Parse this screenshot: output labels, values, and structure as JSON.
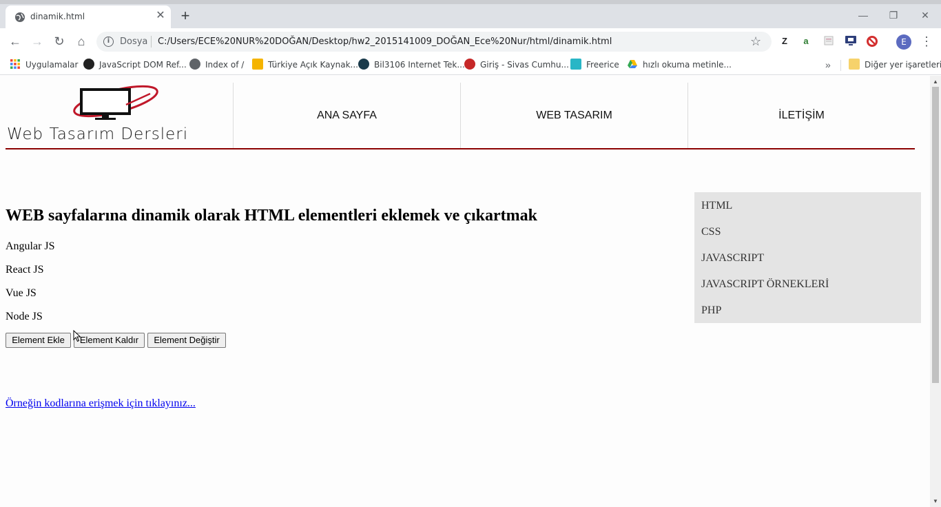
{
  "browser": {
    "tab_title": "dinamik.html",
    "address_scheme": "Dosya",
    "address_url": "C:/Users/ECE%20NUR%20DOĞAN/Desktop/hw2_2015141009_DOĞAN_Ece%20Nur/html/dinamik.html",
    "profile_initial": "E",
    "extensions": [
      "Z",
      "a"
    ],
    "bookmarks": [
      "Uygulamalar",
      "JavaScript DOM Ref...",
      "Index of /",
      "Türkiye Açık Kaynak...",
      "Bil3106 Internet Tek...",
      "Giriş - Sivas Cumhu...",
      "Freerice",
      "hızlı okuma metinle..."
    ],
    "other_bookmarks": "Diğer yer işaretleri"
  },
  "site": {
    "logo_text": "Web Tasarım Dersleri",
    "nav": [
      "ANA SAYFA",
      "WEB TASARIM",
      "İLETİŞİM"
    ]
  },
  "main": {
    "title": "WEB sayfalarına dinamik olarak HTML elementleri eklemek ve çıkartmak",
    "items": [
      "Angular JS",
      "React JS",
      "Vue JS",
      "Node JS"
    ],
    "buttons": {
      "add": "Element Ekle",
      "remove": "Element Kaldır",
      "change": "Element Değiştir"
    },
    "code_link": "Örneğin kodlarına erişmek için tıklayınız..."
  },
  "sidebar": {
    "items": [
      "HTML",
      "CSS",
      "JAVASCRIPT",
      "JAVASCRIPT ÖRNEKLERİ",
      "PHP"
    ]
  }
}
